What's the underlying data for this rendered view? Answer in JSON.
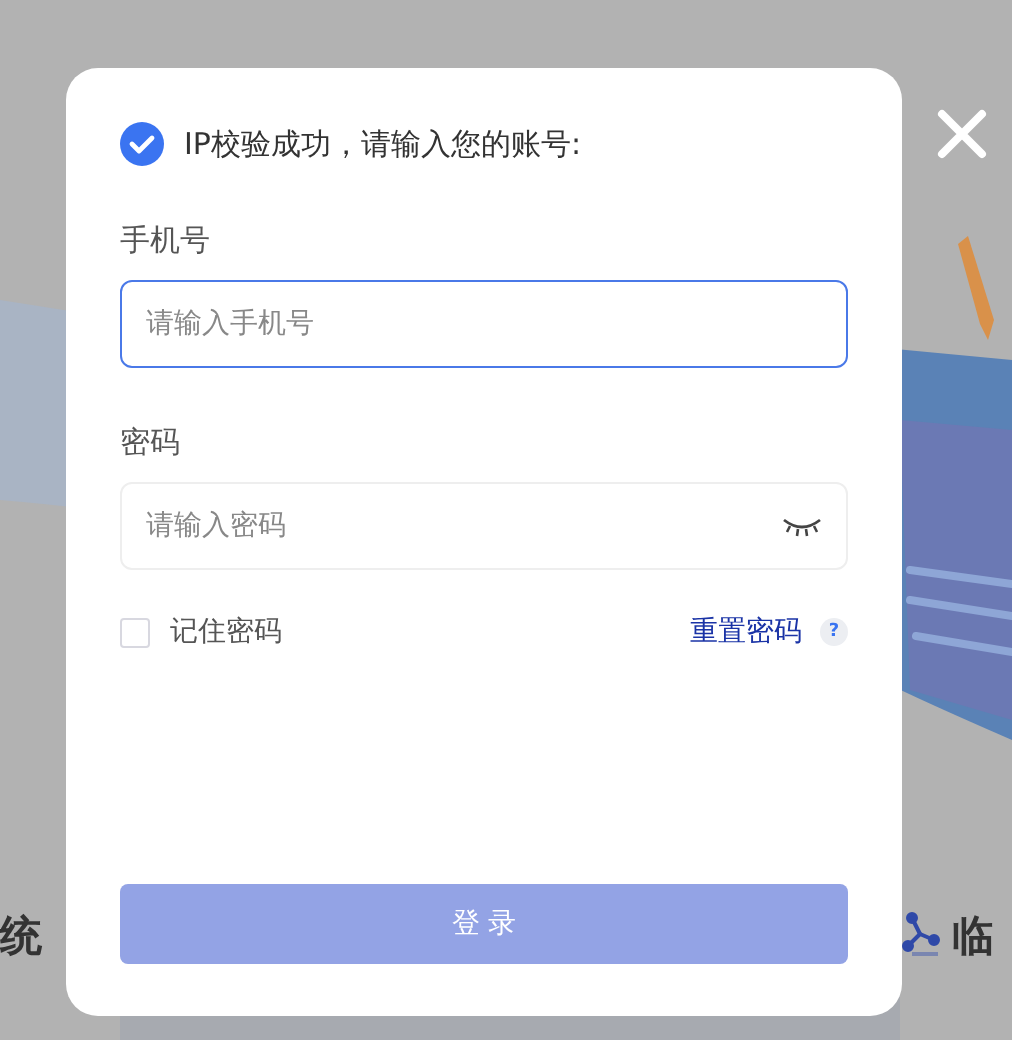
{
  "background": {
    "texts": [
      {
        "text": "统"
      },
      {
        "text": "临"
      }
    ]
  },
  "dialog": {
    "notice": {
      "text": "IP校验成功，请输入您的账号:",
      "kind": "success"
    },
    "fields": [
      {
        "label": "手机号",
        "placeholder": "请输入手机号",
        "kind": "text",
        "focused": true
      },
      {
        "label": "密码",
        "placeholder": "请输入密码",
        "kind": "password",
        "focused": false,
        "password_visible": false
      }
    ],
    "remember": {
      "label": "记住密码",
      "checked": false
    },
    "reset_link": "重置密码",
    "help": "?",
    "submit": {
      "label": "登 录",
      "disabled": true
    }
  }
}
